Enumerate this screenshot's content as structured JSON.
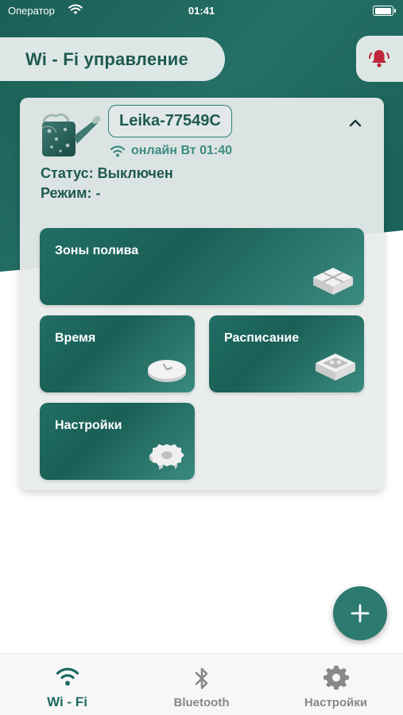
{
  "status_bar": {
    "carrier": "Оператор",
    "time": "01:41"
  },
  "header": {
    "title": "Wi - Fi управление",
    "bell_icon": "bell-icon"
  },
  "colors": {
    "brand_dark": "#1a5f56",
    "brand_light": "#3a8a80",
    "alert": "#c0263a"
  },
  "device": {
    "name": "Leika-77549C",
    "online_text": "онлайн Вт 01:40",
    "status_text": "Статус: Выключен",
    "mode_text": "Режим: -",
    "expanded_icon": "chevron-up-icon",
    "tiles": [
      {
        "label": "Зоны полива",
        "icon": "zones-icon"
      },
      {
        "label": "Время",
        "icon": "timer-icon"
      },
      {
        "label": "Расписание",
        "icon": "schedule-icon"
      },
      {
        "label": "Настройки",
        "icon": "gear-icon"
      }
    ]
  },
  "fab": {
    "icon": "plus-icon"
  },
  "bottom_nav": {
    "items": [
      {
        "label": "Wi - Fi",
        "icon": "wifi-icon",
        "active": true
      },
      {
        "label": "Bluetooth",
        "icon": "bluetooth-icon",
        "active": false
      },
      {
        "label": "Настройки",
        "icon": "gear-icon",
        "active": false
      }
    ]
  }
}
